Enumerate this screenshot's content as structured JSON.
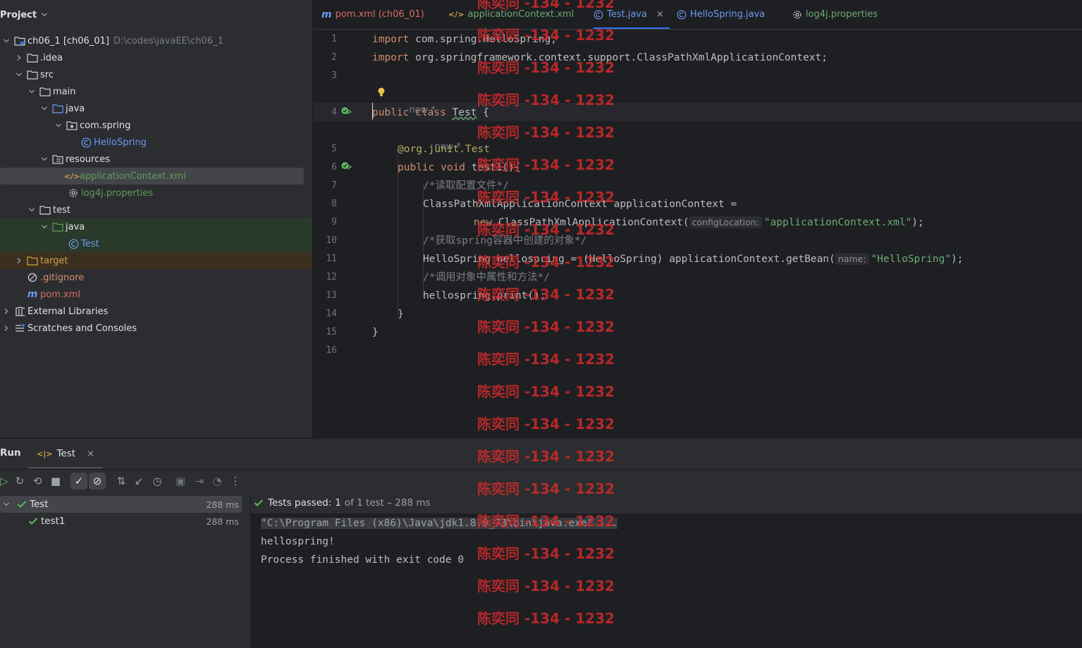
{
  "project": {
    "title": "Project",
    "tree": [
      {
        "label": "ch06_1 [ch06_01]",
        "hint": "D:\\codes\\javaEE\\ch06_1"
      },
      {
        "label": ".idea"
      },
      {
        "label": "src"
      },
      {
        "label": "main"
      },
      {
        "label": "java"
      },
      {
        "label": "com.spring"
      },
      {
        "label": "HelloSpring"
      },
      {
        "label": "resources"
      },
      {
        "label": "applicationContext.xml"
      },
      {
        "label": "log4j.properties"
      },
      {
        "label": "test"
      },
      {
        "label": "java"
      },
      {
        "label": "Test"
      },
      {
        "label": "target"
      },
      {
        "label": ".gitignore"
      },
      {
        "label": "pom.xml"
      },
      {
        "label": "External Libraries"
      },
      {
        "label": "Scratches and Consoles"
      }
    ]
  },
  "tabs": [
    {
      "label": "pom.xml (ch06_01)",
      "icon": "m"
    },
    {
      "label": "applicationContext.xml",
      "icon": "</>"
    },
    {
      "label": "Test.java",
      "icon": "C"
    },
    {
      "label": "HelloSpring.java",
      "icon": "C"
    },
    {
      "label": "log4j.properties",
      "icon": "gear"
    }
  ],
  "editor": {
    "line_numbers": [
      "1",
      "2",
      "3",
      "4",
      "5",
      "6",
      "7",
      "8",
      "9",
      "10",
      "11",
      "12",
      "13",
      "14",
      "15",
      "16"
    ],
    "usage_hint": "new *",
    "code": {
      "l1_kw": "import",
      "l1_rest": " com.spring.HelloSpring;",
      "l2_kw": "import",
      "l2_rest": " org.springframework.context.support.ClassPathXmlApplicationContext;",
      "l4_kw": "public class",
      "l4_name": "Test",
      "l4_rest": " {",
      "l5_ann": "@org.junit.Test",
      "l6_kw": "public void",
      "l6_rest": " test1(){",
      "l7_cmt": "/*读取配置文件*/",
      "l8": "ClassPathXmlApplicationContext applicationContext =",
      "l9_kw": "new",
      "l9_mid": " ClassPathXmlApplicationContext(",
      "l9_hint": "configLocation:",
      "l9_str": "\"applicationContext.xml\"",
      "l9_end": ");",
      "l10_cmt": "/*获取spring容器中创建的对象*/",
      "l11_pre": "HelloSpring hellospring = (HelloSpring) applicationContext.getBean(",
      "l11_hint": "name:",
      "l11_str": "\"HelloSpring\"",
      "l11_end": ");",
      "l12_cmt": "/*调用对象中属性和方法*/",
      "l13": "hellospring.print();",
      "l14": "}",
      "l15": "}"
    }
  },
  "run": {
    "title": "Run",
    "tab_label": "Test",
    "tree": [
      {
        "label": "Test",
        "duration": "288 ms"
      },
      {
        "label": "test1",
        "duration": "288 ms"
      }
    ],
    "status": {
      "passed_label": "Tests passed:",
      "passed_count": "1",
      "of_text": "of 1 test – 288 ms"
    },
    "console": [
      "\"C:\\Program Files (x86)\\Java\\jdk1.8.0_73\\bin\\java.exe\" ...",
      "hellospring!",
      "Process finished with exit code 0"
    ]
  },
  "watermark": "陈奕同 -134 - 1232",
  "colors": {
    "accent": "#3574f0",
    "watermark": "#cc2a2a",
    "success": "#5fb85f"
  }
}
